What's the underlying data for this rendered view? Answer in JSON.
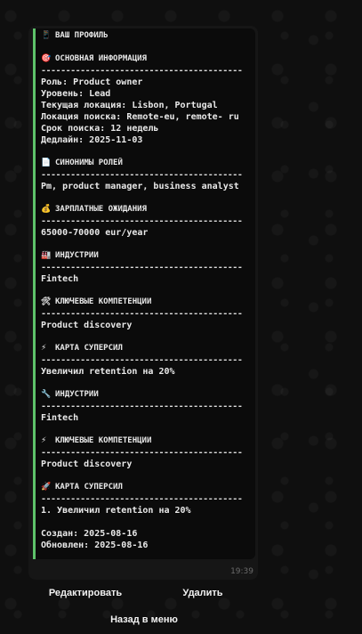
{
  "message": {
    "header": {
      "icon": "phone-icon",
      "glyph": "📱",
      "title": "ВАШ ПРОФИЛЬ"
    },
    "rule": "-----------------------------------------",
    "basic": {
      "icon": "target-icon",
      "glyph": "🎯",
      "title": "ОСНОВНАЯ ИНФОРМАЦИЯ",
      "lines": [
        "Роль: Product owner",
        "Уровень: Lead",
        "Текущая локация: Lisbon, Portugal",
        "Локация поиска: Remote-eu, remote- ru",
        "Срок поиска: 12 недель",
        "Дедлайн: 2025-11-03"
      ]
    },
    "sections": [
      {
        "icon": "document-icon",
        "glyph": "📄",
        "title": "СИНОНИМЫ РОЛЕЙ",
        "text": "Pm, product manager, business analyst"
      },
      {
        "icon": "money-bag-icon",
        "glyph": "💰",
        "title": "ЗАРПЛАТНЫЕ ОЖИДАНИЯ",
        "text": "65000-70000 eur/year"
      },
      {
        "icon": "factory-icon",
        "glyph": "🏭",
        "title": "ИНДУСТРИИ",
        "text": "Fintech"
      },
      {
        "icon": "tools-icon",
        "glyph": "🛠",
        "title": "КЛЮЧЕВЫЕ КОМПЕТЕНЦИИ",
        "text": "Product discovery"
      },
      {
        "icon": "lightning-icon",
        "glyph": "⚡",
        "title": "КАРТА СУПЕРСИЛ",
        "text": "Увеличил retention на 20%"
      },
      {
        "icon": "wrench-icon",
        "glyph": "🔧",
        "title": "ИНДУСТРИИ",
        "text": "Fintech"
      },
      {
        "icon": "lightning-icon",
        "glyph": "⚡",
        "title": "КЛЮЧЕВЫЕ КОМПЕТЕНЦИИ",
        "text": "Product discovery"
      },
      {
        "icon": "rocket-icon",
        "glyph": "🚀",
        "title": "КАРТА СУПЕРСИЛ",
        "text": "1. Увеличил retention на 20%"
      }
    ],
    "created": "Создан: 2025-08-16",
    "updated": "Обновлен: 2025-08-16",
    "time": "19:39"
  },
  "keyboard": {
    "edit_label": "Редактировать",
    "delete_label": "Удалить",
    "back_label": "Назад в меню"
  },
  "colors": {
    "accent": "#5ec26a",
    "background": "#0f0f0f",
    "bubble": "#0b0b0b"
  }
}
